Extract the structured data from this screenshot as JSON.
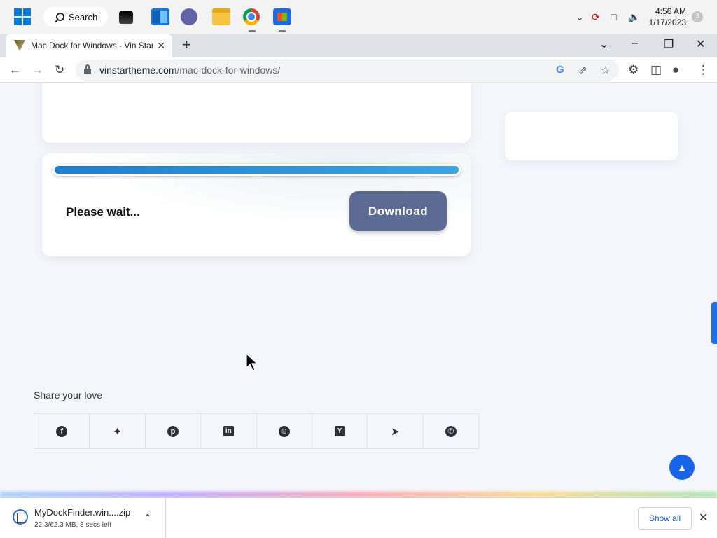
{
  "taskbar": {
    "search_label": "Search",
    "time": "4:56 AM",
    "date": "1/17/2023",
    "notification_count": "3"
  },
  "browser": {
    "tab_title": "Mac Dock for Windows - Vin Star",
    "url_host": "vinstartheme.com",
    "url_path": "/mac-dock-for-windows/"
  },
  "page": {
    "progress": 1.0,
    "wait_text": "Please wait...",
    "download_label": "Download",
    "share_title": "Share your love",
    "share_items": [
      "facebook",
      "twitter",
      "pinterest",
      "linkedin",
      "reddit",
      "hackernews",
      "telegram",
      "whatsapp"
    ]
  },
  "download_shelf": {
    "file_name": "MyDockFinder.win....zip",
    "status": "22.3/62.3 MB, 3 secs left",
    "show_all_label": "Show all"
  },
  "colors": {
    "accent_blue": "#1d7fd0",
    "download_button": "#5b6b94",
    "rocket_button": "#1764e8"
  }
}
